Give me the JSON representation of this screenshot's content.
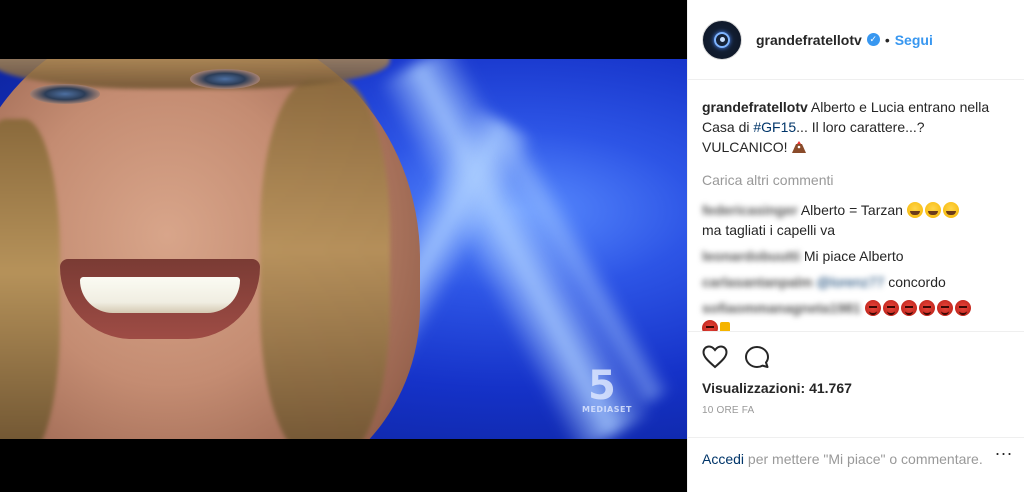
{
  "video": {
    "watermark_number": "5",
    "watermark_brand": "MEDIASET"
  },
  "header": {
    "username": "grandefratellotv",
    "verified_icon": "verified-badge-icon",
    "separator": "•",
    "follow_label": "Segui"
  },
  "caption": {
    "username": "grandefratellotv",
    "text_before": " Alberto e Lucia entrano nella Casa di ",
    "hashtag": "#GF15",
    "text_after": "... Il loro carattere...? VULCANICO! "
  },
  "load_more": "Carica altri commenti",
  "comments": [
    {
      "user": "federicasinger",
      "text": "Alberto = Tarzan",
      "emojis": "😂😂😂",
      "text2": "ma tagliati i capelli va"
    },
    {
      "user": "leonardobuutti",
      "text": "Mi piace Alberto"
    },
    {
      "user": "carlasantanpalm",
      "mention": "@lorenz77",
      "text": " concordo"
    },
    {
      "user": "sofiaommanagneta1981",
      "emojis": "😈😈😈😈😈😈😈🤘"
    }
  ],
  "actions": {
    "like_icon": "heart-icon",
    "comment_icon": "comment-bubble-icon",
    "views": "Visualizzazioni: 41.767",
    "time": "10 ORE FA"
  },
  "login": {
    "link": "Accedi",
    "text": " per mettere \"Mi piace\" o commentare."
  },
  "more_options": "..."
}
